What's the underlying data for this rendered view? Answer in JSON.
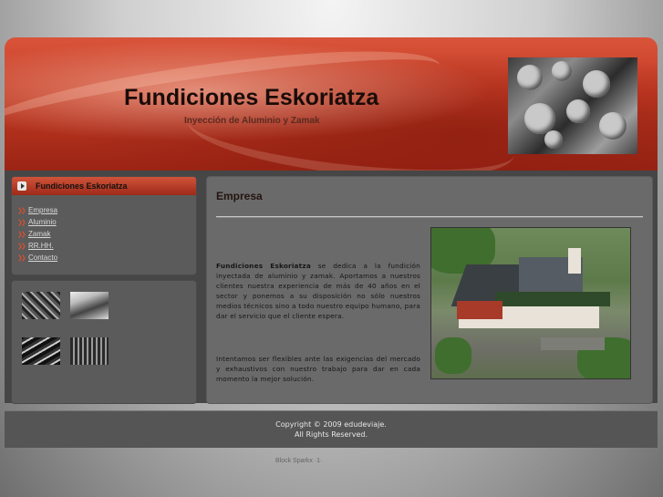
{
  "header": {
    "title": "Fundiciones Eskoriatza",
    "subtitle": "Inyección de Aluminio y Zamak",
    "photo_icon": "metal-parts-photo"
  },
  "sidebar": {
    "heading": "Fundiciones Eskoriatza",
    "heading_icon": "play-icon",
    "items": [
      {
        "label": "Empresa",
        "icon": "double-arrow-icon"
      },
      {
        "label": "Aluminio",
        "icon": "double-arrow-icon"
      },
      {
        "label": "Zamak",
        "icon": "double-arrow-icon"
      },
      {
        "label": "RR.HH.",
        "icon": "double-arrow-icon"
      },
      {
        "label": "Contacto",
        "icon": "double-arrow-icon"
      }
    ],
    "gallery": [
      "thumbnail-photo",
      "thumbnail-photo",
      "thumbnail-photo",
      "thumbnail-photo"
    ]
  },
  "main": {
    "title": "Empresa",
    "para1_bold": "Fundiciones Eskoriatza",
    "para1_rest": " se dedica a la fundición inyectada de aluminio y zamak. Aportamos a nuestros clientes nuestra experiencia de más de 40 años en el sector y ponemos a su disposición no sólo nuestros medios técnicos sino a todo nuestro equipo humano, para dar el servicio que el cliente espera.",
    "para2": "Intentamos ser flexibles ante las exigencias del mercado y exhaustivos con nuestro trabajo para dar en cada momento la mejor solución.",
    "photo_icon": "factory-aerial-photo"
  },
  "footer": {
    "copyright": "Copyright © 2009 edudeviaje.",
    "rights": "All Rights Reserved."
  },
  "credit": "Block Sparkx ·1·",
  "colors": {
    "accent": "#c43b24",
    "link": "#d8d8d8",
    "panel": "#5b5b5b",
    "content": "#6a6a6a"
  }
}
